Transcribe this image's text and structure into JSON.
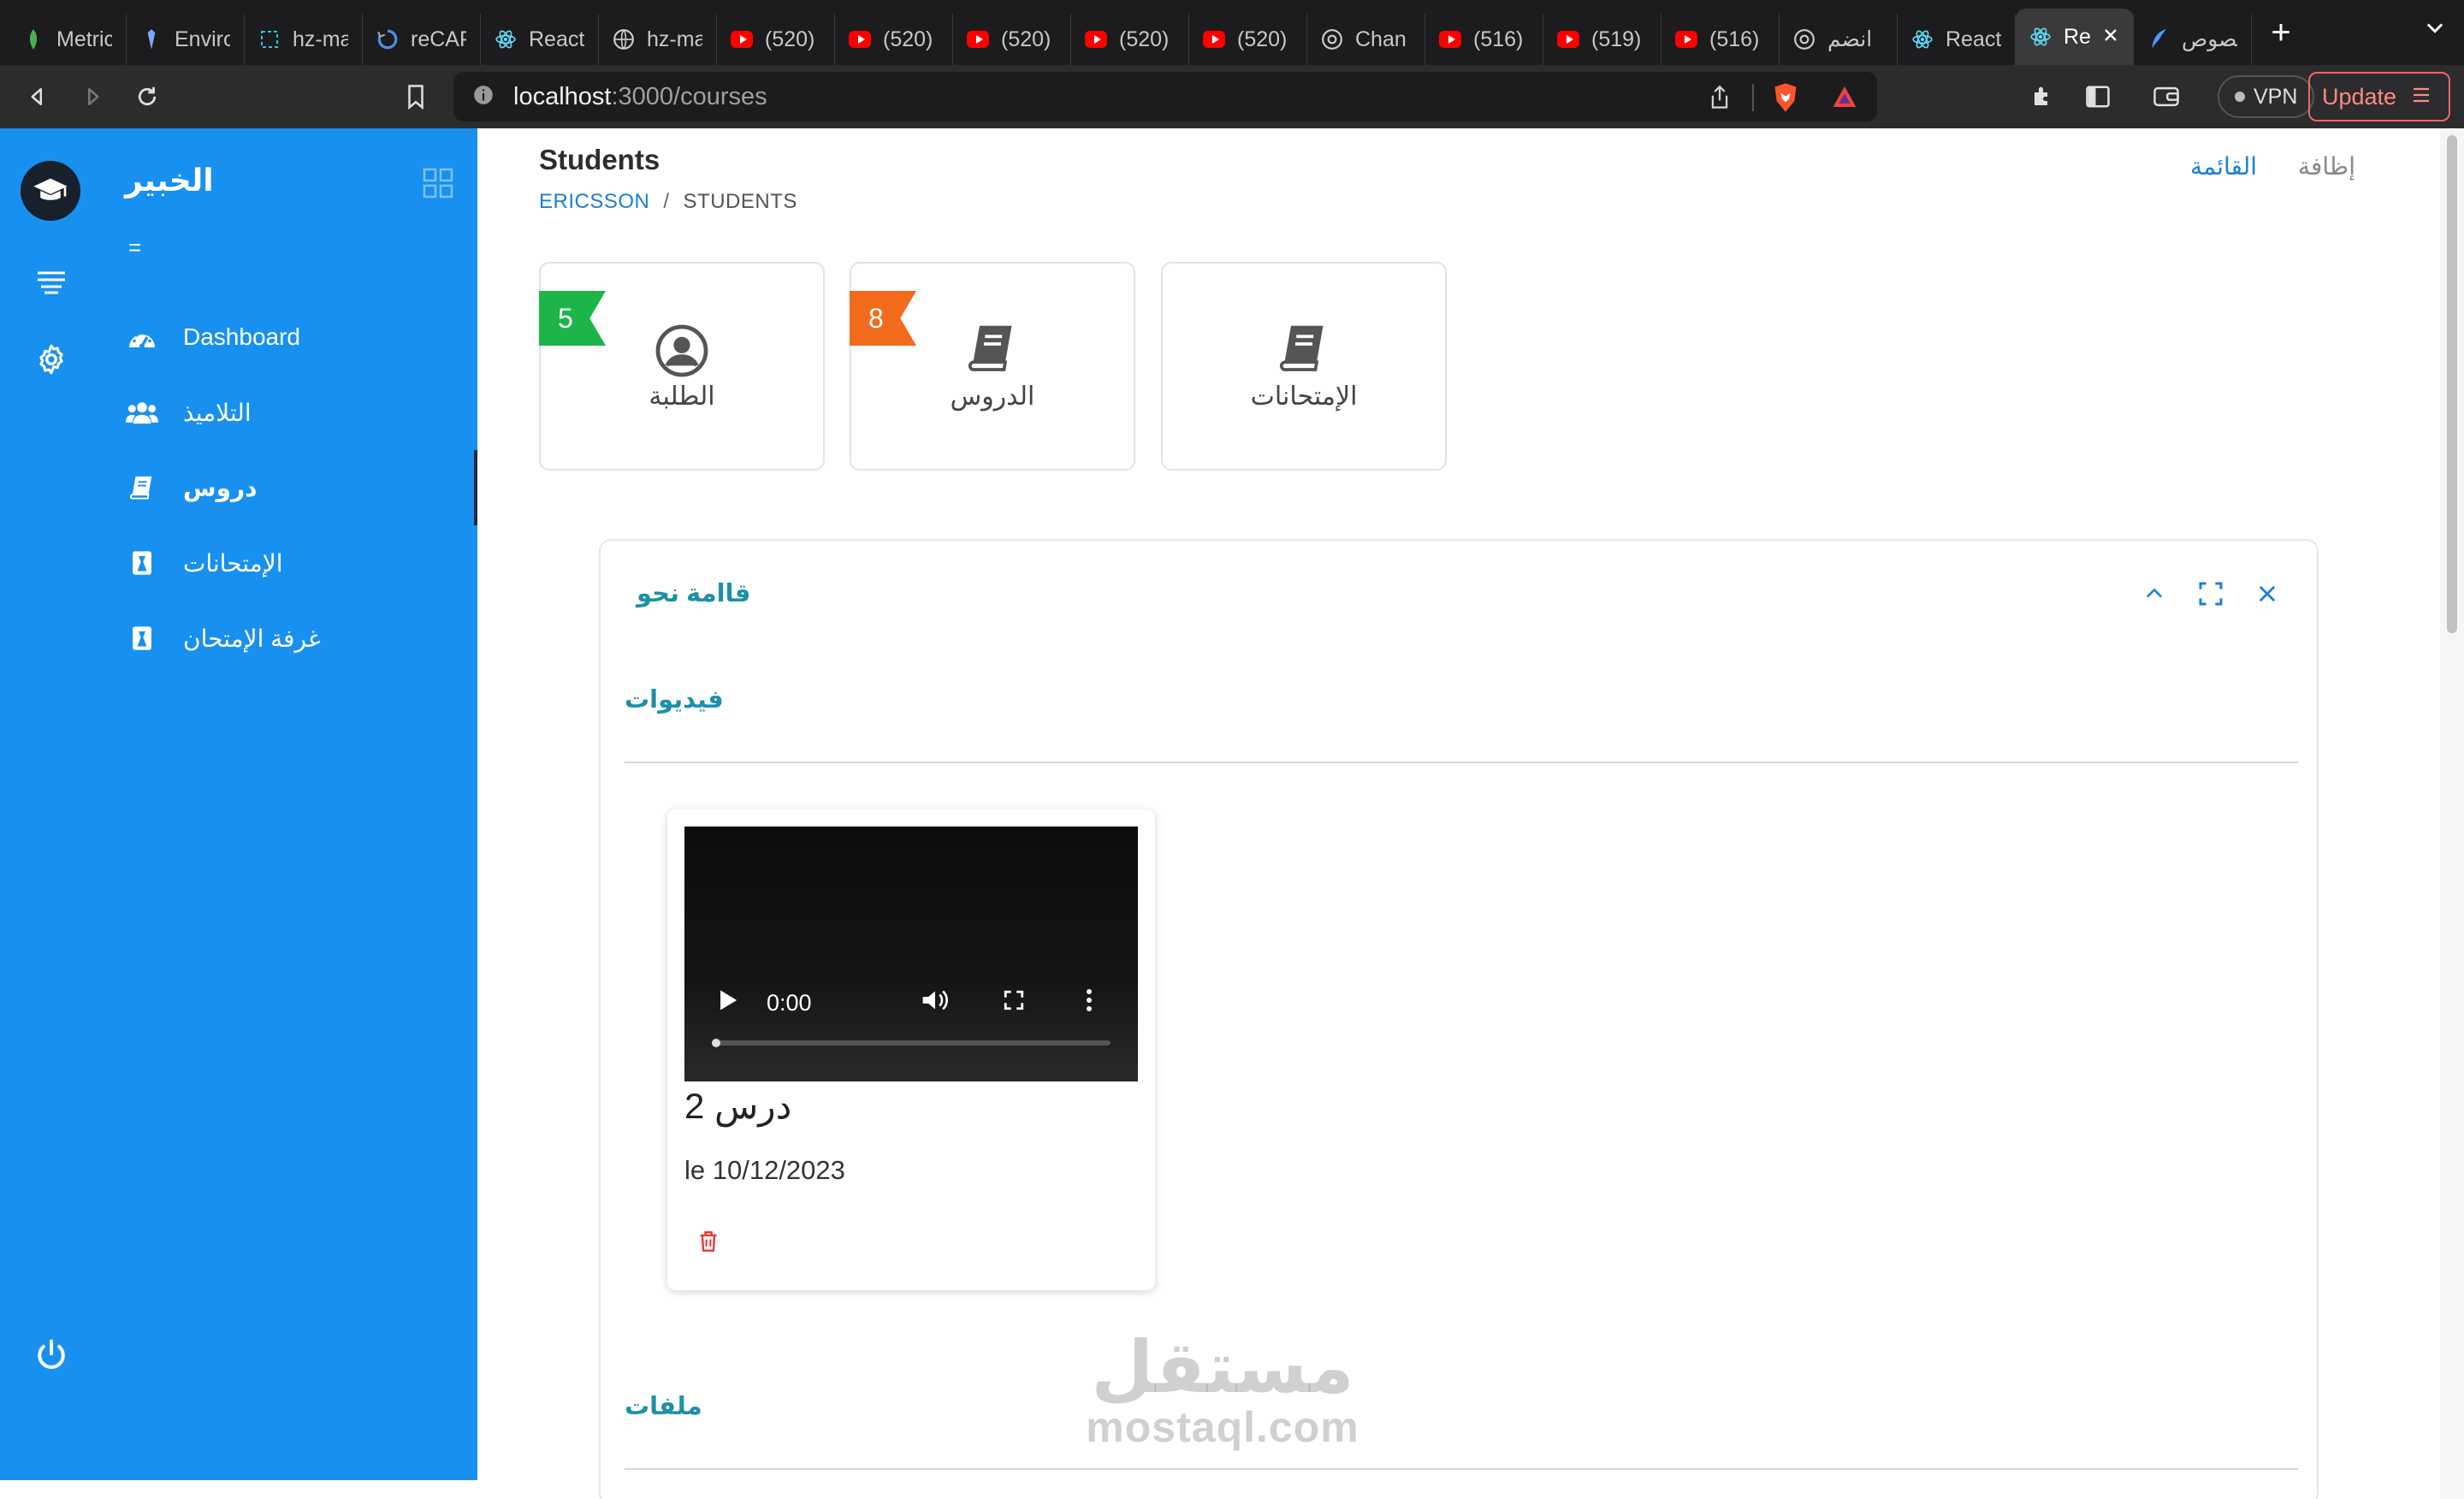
{
  "browser": {
    "tabs": [
      {
        "label": "Metric",
        "icon": "leaf-icon",
        "color": "#4caf50"
      },
      {
        "label": "Enviro",
        "icon": "pen-icon",
        "color": "#7ea8ff"
      },
      {
        "label": "hz-ma",
        "icon": "frame-icon",
        "color": "#36c1d1"
      },
      {
        "label": "reCAP",
        "icon": "recaptcha-icon",
        "color": "#4a90e2"
      },
      {
        "label": "React",
        "icon": "react-icon",
        "color": "#61dafb"
      },
      {
        "label": "hz-ma",
        "icon": "globe-icon",
        "color": "#cccccc"
      },
      {
        "label": "(520)",
        "icon": "youtube-icon",
        "color": "#ff0000"
      },
      {
        "label": "(520)",
        "icon": "youtube-icon",
        "color": "#ff0000"
      },
      {
        "label": "(520)",
        "icon": "youtube-icon",
        "color": "#ff0000"
      },
      {
        "label": "(520)",
        "icon": "youtube-icon",
        "color": "#ff0000"
      },
      {
        "label": "(520)",
        "icon": "youtube-icon",
        "color": "#ff0000"
      },
      {
        "label": "Chan",
        "icon": "chatgpt-icon",
        "color": "#cccccc"
      },
      {
        "label": "(516)",
        "icon": "youtube-icon",
        "color": "#ff0000"
      },
      {
        "label": "(519)",
        "icon": "youtube-icon",
        "color": "#ff0000"
      },
      {
        "label": "(516)",
        "icon": "youtube-icon",
        "color": "#ff0000"
      },
      {
        "label": "انضم",
        "icon": "chatgpt-icon",
        "color": "#cccccc"
      },
      {
        "label": "React",
        "icon": "react-icon",
        "color": "#61dafb"
      },
      {
        "label": "Re",
        "icon": "react-icon",
        "color": "#61dafb",
        "active": true
      },
      {
        "label": "نصوص",
        "icon": "quill-icon",
        "color": "#4a9bff"
      }
    ],
    "url_host": "localhost",
    "url_path": ":3000/courses",
    "vpn_label": "VPN",
    "update_label": "Update"
  },
  "sidebar": {
    "brand": "الخبير",
    "collapse_glyph": "=",
    "items": [
      {
        "label": "Dashboard",
        "icon": "dashboard-gauge-icon"
      },
      {
        "label": "التلاميذ",
        "icon": "users-icon"
      },
      {
        "label": "دروس",
        "icon": "book-icon",
        "active": true
      },
      {
        "label": "الإمتحانات",
        "icon": "exam-icon"
      },
      {
        "label": "غرفة الإمتحان",
        "icon": "exam-room-icon"
      }
    ],
    "background": "#1890f0"
  },
  "header": {
    "title": "Students",
    "breadcrumb": {
      "root": "ERICSSON",
      "separator": "/",
      "current": "STUDENTS"
    },
    "tabs": [
      {
        "label": "القائمة",
        "active": true
      },
      {
        "label": "إظافة",
        "active": false
      }
    ]
  },
  "stats": [
    {
      "label": "الطلبة",
      "badge": "5",
      "badge_color": "#1db44a",
      "icon": "user-circle-icon"
    },
    {
      "label": "الدروس",
      "badge": "8",
      "badge_color": "#f26a1b",
      "icon": "book-icon"
    },
    {
      "label": "الإمتحانات",
      "badge": "",
      "badge_color": "",
      "icon": "book-icon"
    }
  ],
  "panel": {
    "title": "قاامة نحو",
    "videos_label": "فيديوات",
    "files_label": "ملفات",
    "video": {
      "time": "0:00",
      "progress": 0,
      "title": "درس 2",
      "date": "le 10/12/2023"
    }
  },
  "watermark": {
    "arabic": "مستقل",
    "latin": "mostaql.com"
  },
  "colors": {
    "accent": "#1b7fd4",
    "section": "#1f8fa8",
    "delete": "#e53935"
  }
}
